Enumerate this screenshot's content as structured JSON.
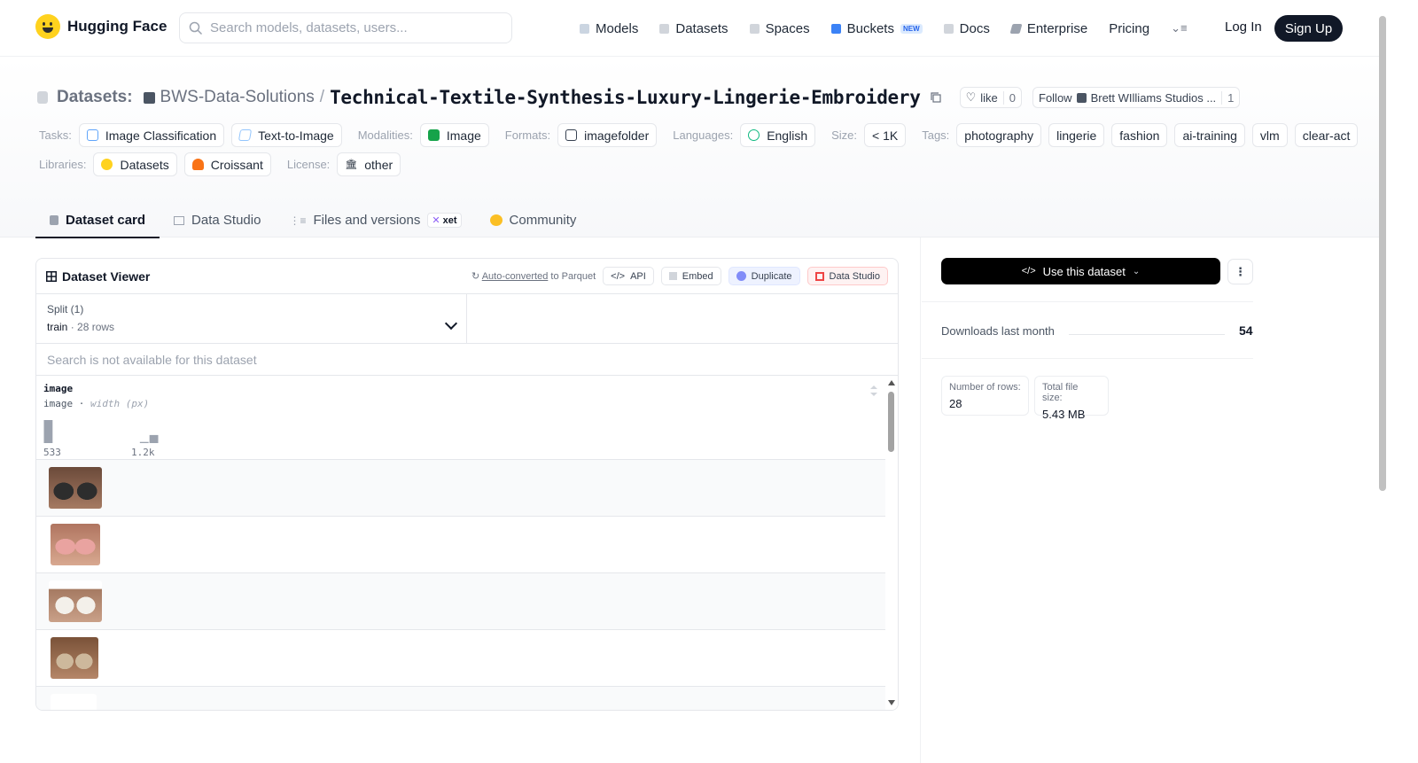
{
  "header": {
    "logo_text": "Hugging Face",
    "search_placeholder": "Search models, datasets, users...",
    "nav": [
      {
        "label": "Models"
      },
      {
        "label": "Datasets"
      },
      {
        "label": "Spaces"
      },
      {
        "label": "Buckets",
        "badge": "NEW"
      },
      {
        "label": "Docs"
      },
      {
        "label": "Enterprise"
      },
      {
        "label": "Pricing"
      }
    ],
    "login": "Log In",
    "signup": "Sign Up"
  },
  "repo": {
    "type_label": "Datasets:",
    "org": "BWS-Data-Solutions",
    "separator": "/",
    "name": "Technical-Textile-Synthesis-Luxury-Lingerie-Embroidery",
    "like_label": "like",
    "like_count": "0",
    "follow_label": "Follow",
    "follow_org": "Brett WIlliams Studios ...",
    "follow_count": "1"
  },
  "tags": {
    "tasks_label": "Tasks:",
    "tasks": [
      "Image Classification",
      "Text-to-Image"
    ],
    "modalities_label": "Modalities:",
    "modalities": [
      "Image"
    ],
    "formats_label": "Formats:",
    "formats": [
      "imagefolder"
    ],
    "languages_label": "Languages:",
    "languages": [
      "English"
    ],
    "size_label": "Size:",
    "size": "< 1K",
    "tags_label": "Tags:",
    "tags": [
      "photography",
      "lingerie",
      "fashion",
      "ai-training",
      "vlm",
      "clear-act"
    ],
    "libraries_label": "Libraries:",
    "libraries": [
      "Datasets",
      "Croissant"
    ],
    "license_label": "License:",
    "license": "other"
  },
  "tabs": [
    {
      "label": "Dataset card",
      "active": true
    },
    {
      "label": "Data Studio"
    },
    {
      "label": "Files and versions",
      "badge": "xet"
    },
    {
      "label": "Community"
    }
  ],
  "viewer": {
    "title": "Dataset Viewer",
    "auto_converted": "Auto-converted",
    "to_parquet": "to Parquet",
    "api": "API",
    "embed": "Embed",
    "duplicate": "Duplicate",
    "data_studio": "Data Studio",
    "split_label": "Split (1)",
    "split_name": "train",
    "split_rows": "28 rows",
    "search_msg": "Search is not available for this dataset",
    "column": {
      "name": "image",
      "type": "image",
      "stat": "width (px)",
      "hist_min": "533",
      "hist_max": "1.2k",
      "histogram": [
        1.0,
        0.0,
        0.0,
        0.0,
        0.0,
        0.0,
        0.0,
        0.0,
        0.0,
        0.0,
        0.05,
        0.35
      ]
    },
    "row_count_visible": 5
  },
  "sidebar": {
    "use_dataset": "Use this dataset",
    "downloads_label": "Downloads last month",
    "downloads": "54",
    "rows_label": "Number of rows:",
    "rows": "28",
    "size_label": "Total file size:",
    "size": "5.43 MB"
  },
  "colors": {
    "brand_yellow": "#ffd21e",
    "dark": "#111827",
    "muted": "#6b7280"
  }
}
